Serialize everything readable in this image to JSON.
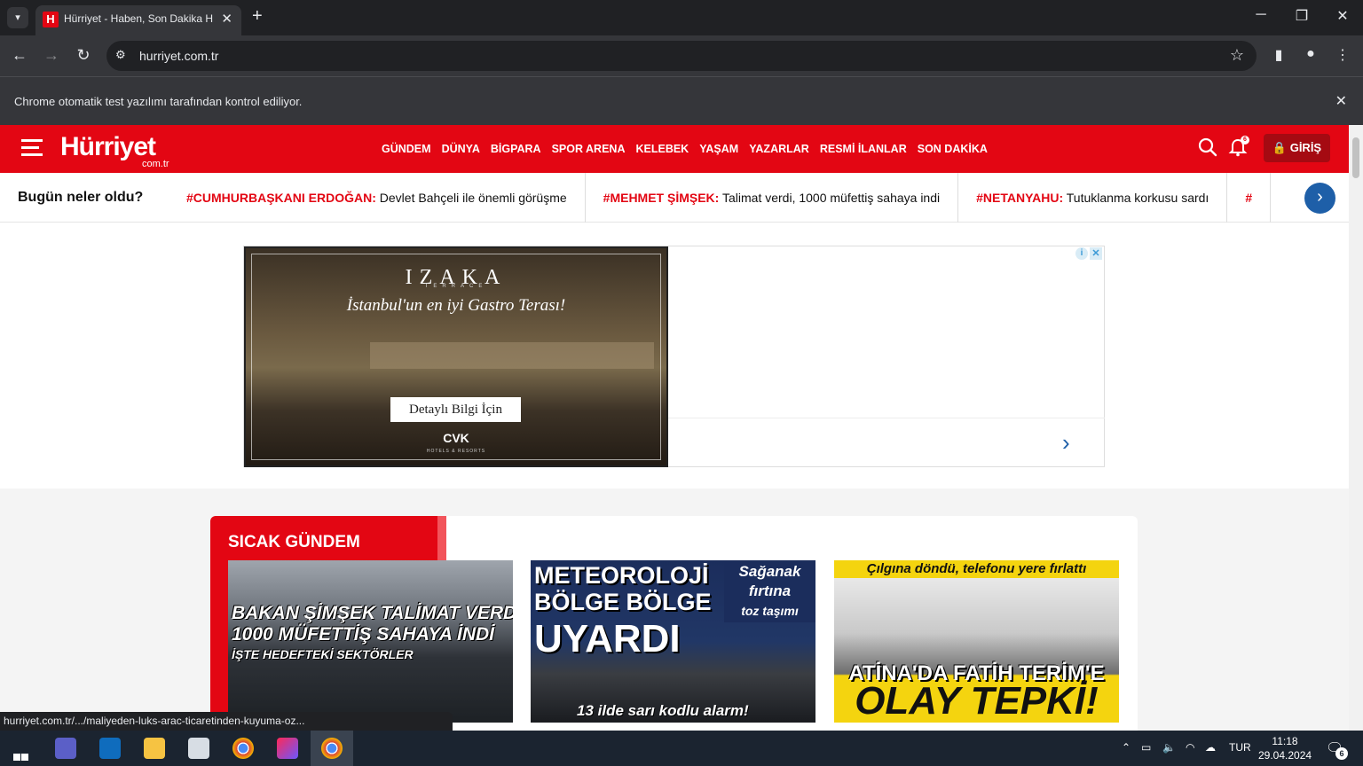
{
  "browser": {
    "tab_title": "Hürriyet - Haben, Son Dakika Haberler",
    "tab_favicon": "H",
    "url": "hurriyet.com.tr",
    "infobar_text": "Chrome otomatik test yazılımı tarafından kontrol ediliyor.",
    "status_url": "hurriyet.com.tr/.../maliyeden-luks-arac-ticaretinden-kuyuma-oz..."
  },
  "site": {
    "logo": "Hürriyet",
    "logo_sub": "com.tr",
    "nav": [
      "GÜNDEM",
      "DÜNYA",
      "BİGPARA",
      "SPOR ARENA",
      "KELEBEK",
      "YAŞAM",
      "YAZARLAR",
      "RESMİ İLANLAR",
      "SON DAKİKA"
    ],
    "notification_count": "6",
    "login_label": "GİRİŞ",
    "accent_color": "#e30613"
  },
  "trending": {
    "title": "Bugün neler oldu?",
    "items": [
      {
        "tag": "#CUMHURBAŞKANI ERDOĞAN:",
        "text": "Devlet Bahçeli ile önemli görüşme"
      },
      {
        "tag": "#MEHMET ŞİMŞEK:",
        "text": "Talimat verdi, 1000 müfettiş sahaya indi"
      },
      {
        "tag": "#NETANYAHU:",
        "text": "Tutuklanma korkusu sardı"
      },
      {
        "tag": "#",
        "text": ""
      }
    ]
  },
  "ad": {
    "brand": "IZAKA",
    "brand_sub": "TERRACE",
    "tagline": "İstanbul'un en iyi Gastro Terası!",
    "cta": "Detaylı Bilgi İçin",
    "logo": "CVK",
    "logo_sub": "HOTELS & RESORTS"
  },
  "hot": {
    "title": "SICAK GÜNDEM",
    "cards": [
      {
        "line1": "BAKAN ŞİMŞEK TALİMAT VERDİ",
        "line2": "1000 MÜFETTİŞ SAHAYA İNDİ",
        "line3": "İŞTE HEDEFTEKİ SEKTÖRLER"
      },
      {
        "line1": "METEOROLOJİ",
        "line2": "BÖLGE BÖLGE",
        "line3": "UYARDI",
        "side1": "Sağanak",
        "side2": "fırtına",
        "side3": "toz taşımı",
        "bottom": "13 ilde sarı kodlu alarm!"
      },
      {
        "top": "Çılgına döndü, telefonu yere fırlattı",
        "line1": "ATİNA'DA FATİH TERİM'E",
        "line2": "OLAY TEPKİ!"
      }
    ]
  },
  "taskbar": {
    "lang": "TUR",
    "time": "11:18",
    "date": "29.04.2024",
    "notifications": "6"
  }
}
